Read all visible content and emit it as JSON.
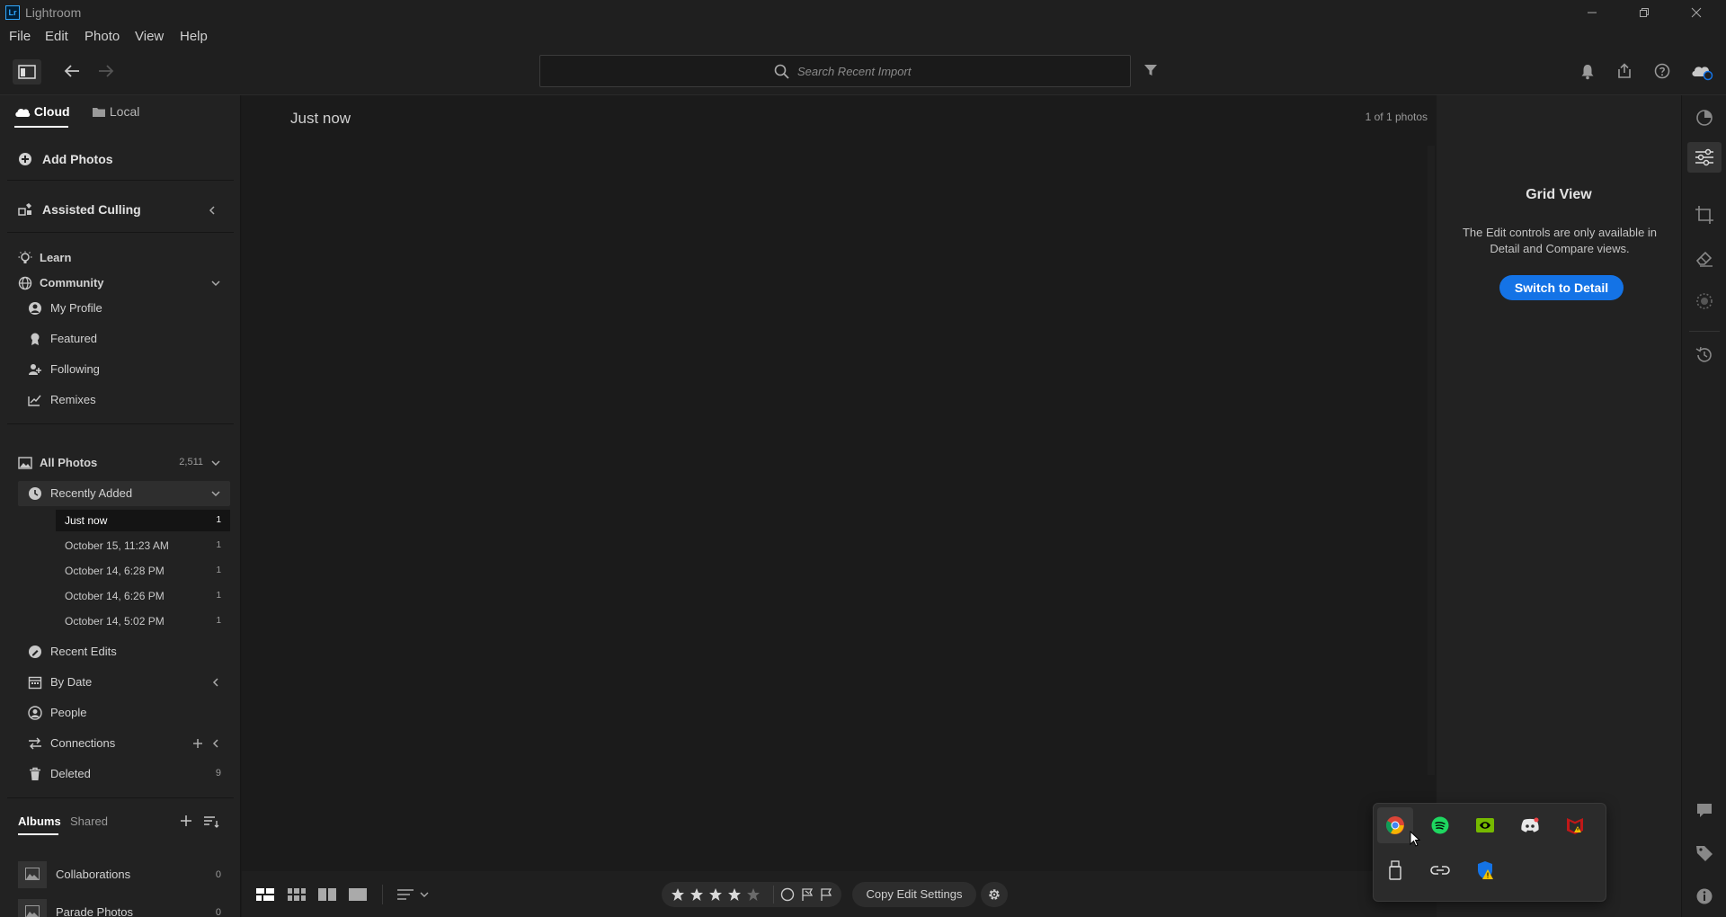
{
  "window": {
    "app_title": "Lightroom",
    "logo_text": "Lr"
  },
  "menu": [
    "File",
    "Edit",
    "Photo",
    "View",
    "Help"
  ],
  "search": {
    "placeholder": "Search Recent Import"
  },
  "sidebar": {
    "tabs": {
      "cloud": "Cloud",
      "local": "Local"
    },
    "add_photos": "Add Photos",
    "assisted_culling": "Assisted Culling",
    "learn": "Learn",
    "community": "Community",
    "community_items": [
      "My Profile",
      "Featured",
      "Following",
      "Remixes"
    ],
    "all_photos": {
      "label": "All Photos",
      "count": "2,511"
    },
    "recently_added": "Recently Added",
    "recent_items": [
      {
        "label": "Just now",
        "count": "1"
      },
      {
        "label": "October 15, 11:23 AM",
        "count": "1"
      },
      {
        "label": "October 14, 6:28 PM",
        "count": "1"
      },
      {
        "label": "October 14, 6:26 PM",
        "count": "1"
      },
      {
        "label": "October 14, 5:02 PM",
        "count": "1"
      }
    ],
    "recent_edits": "Recent Edits",
    "by_date": "By Date",
    "people": "People",
    "connections": "Connections",
    "deleted": {
      "label": "Deleted",
      "count": "9"
    },
    "albums_tabs": {
      "albums": "Albums",
      "shared": "Shared"
    },
    "albums": [
      {
        "label": "Collaborations",
        "count": "0"
      },
      {
        "label": "Parade Photos",
        "count": "0"
      }
    ]
  },
  "main": {
    "section_title": "Just now",
    "photo_count": "1 of 1 photos"
  },
  "right_panel": {
    "heading": "Grid View",
    "description": "The Edit controls are only available in Detail and Compare views.",
    "button": "Switch to Detail"
  },
  "bottom_bar": {
    "copy_edit_settings": "Copy Edit Settings",
    "stars": 5
  },
  "tray": {
    "icons": [
      "chrome-icon",
      "spotify-icon",
      "nvidia-icon",
      "discord-icon",
      "mcafee-icon",
      "usb-drive-icon",
      "link-icon",
      "defender-warning-icon"
    ]
  },
  "colors": {
    "accent": "#1473e6",
    "selected_row": "#141414",
    "spotify": "#1ed760",
    "nvidia": "#76b900",
    "mcafee": "#c01818"
  }
}
